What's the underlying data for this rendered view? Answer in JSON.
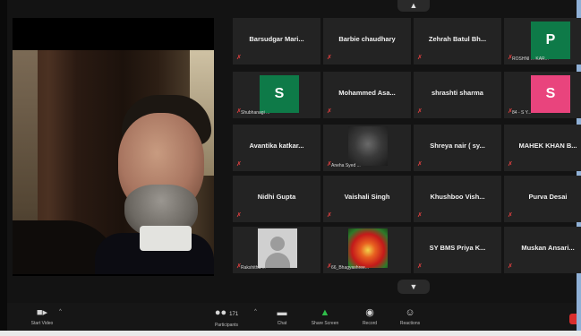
{
  "gallery": {
    "tiles": [
      {
        "name": "Barsudgar  Mari..."
      },
      {
        "name": "Barbie chaudhary"
      },
      {
        "name": "Zehrah Batul Bh..."
      },
      {
        "avatar": "P",
        "avatar_color": "#0e7a48",
        "tag": "ROSHNI ... KAR..."
      },
      {
        "avatar": "S",
        "avatar_color": "#0e7a48",
        "tag": "Shubhanagi ..."
      },
      {
        "name": "Mohammed  Asa..."
      },
      {
        "name": "shrashti sharma"
      },
      {
        "avatar": "S",
        "avatar_color": "#e9447d",
        "tag": "84 - S Y..."
      },
      {
        "name": "Avantika  katkar..."
      },
      {
        "photo": "masked-person",
        "tag": "Aneha Syed ..."
      },
      {
        "name": "Shreya  nair  ( sy..."
      },
      {
        "name": "MAHEK KHAN B..."
      },
      {
        "name": "Nidhi Gupta"
      },
      {
        "name": "Vaishali Singh"
      },
      {
        "name": "Khushboo Vish..."
      },
      {
        "name": "Purva Desai"
      },
      {
        "photo": "default-user",
        "tag": "Rakshitha ..."
      },
      {
        "photo": "flower",
        "tag": "66_Bhagyashree..."
      },
      {
        "name": "SY BMS Priya K..."
      },
      {
        "name": "Muskan  Ansari..."
      }
    ]
  },
  "toolbar": {
    "video_label": "Start Video",
    "participants_label": "Participants",
    "participants_count": "171",
    "chat_label": "Chat",
    "share_label": "Share Screen",
    "record_label": "Record",
    "reactions_label": "Reactions"
  },
  "icons": {
    "scroll_up": "chevron-up-icon",
    "scroll_down": "chevron-down-icon",
    "mic_muted": "mic-muted-icon",
    "video": "video-off-icon",
    "participants": "participants-icon",
    "chat": "chat-icon",
    "share": "share-screen-icon",
    "record": "record-icon",
    "reactions": "reactions-icon"
  }
}
